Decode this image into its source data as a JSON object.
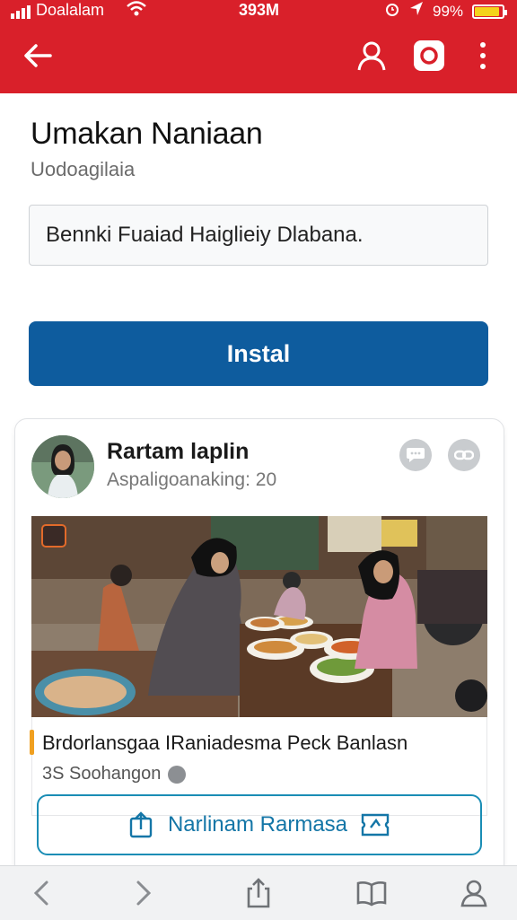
{
  "status_bar": {
    "carrier": "Doalalam",
    "time": "393M",
    "battery": "99%",
    "battery_level": 0.95,
    "icons": [
      "signal-icon",
      "wifi-icon",
      "alarm-icon",
      "location-icon",
      "battery-icon"
    ]
  },
  "appbar": {
    "background": "#d9202a",
    "icons": [
      "back-arrow-icon",
      "user-icon",
      "instagram-icon",
      "more-vertical-icon"
    ]
  },
  "app": {
    "title": "Umakan Naniaan",
    "subtitle": "Uodoagilaia",
    "field_text": "Bennki Fuaiad Haiglieiy Dlabana.",
    "install_label": "Instal",
    "install_color": "#0e5c9e"
  },
  "post": {
    "author": "Rartam lapIin",
    "meta": "Aspaligoanaking: 20",
    "actions": [
      "comment-bubble-icon",
      "link-icon"
    ],
    "caption": "Brdorlansgaa IRaniadesma  Peck Banlasn",
    "stats": "3S Soohangon",
    "accent_color": "#f0a020",
    "button_label": "Narlinam Rarmasa",
    "button_color": "#1a8db5"
  },
  "bottom_nav": {
    "icons": [
      "nav-back-icon",
      "nav-forward-icon",
      "share-icon",
      "bookmarks-icon",
      "profile-icon"
    ]
  }
}
